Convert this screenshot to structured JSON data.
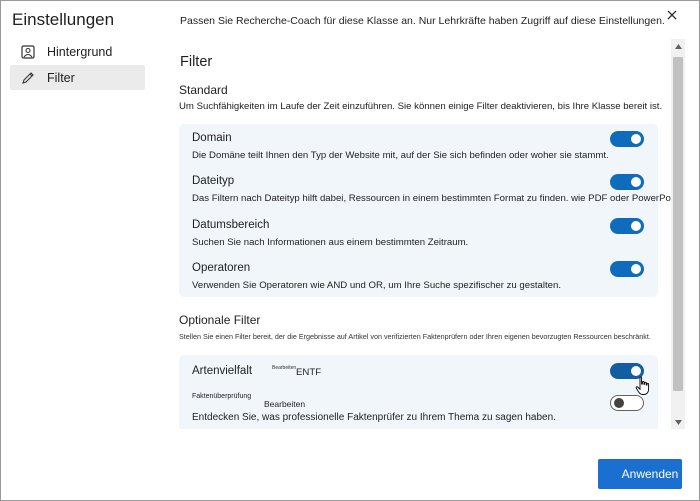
{
  "sidebar": {
    "title": "Einstellungen",
    "items": [
      {
        "label": "Hintergrund",
        "icon": "image-icon",
        "active": false
      },
      {
        "label": "Filter",
        "icon": "pencil-icon",
        "active": true
      }
    ]
  },
  "header": {
    "description": "Passen Sie Recherche-Coach für diese Klasse an. Nur Lehrkräfte haben Zugriff auf diese Einstellungen."
  },
  "panel": {
    "title": "Filter",
    "standard": {
      "heading": "Standard",
      "description": "Um Suchfähigkeiten im Laufe der Zeit einzuführen. Sie können einige Filter deaktivieren, bis Ihre Klasse bereit ist.",
      "items": [
        {
          "title": "Domain",
          "description": "Die Domäne teilt Ihnen den Typ der Website mit, auf der Sie sich befinden oder woher sie stammt.",
          "on": true
        },
        {
          "title": "Dateityp",
          "description": "Das Filtern nach Dateityp hilft dabei, Ressourcen in einem bestimmten Format zu finden. wie PDF oder PowerPoint.",
          "on": true
        },
        {
          "title": "Datumsbereich",
          "description": "Suchen Sie nach Informationen aus einem bestimmten Zeitraum.",
          "on": true
        },
        {
          "title": "Operatoren",
          "description": "Verwenden Sie Operatoren wie AND und OR, um Ihre Suche spezifischer zu gestalten.",
          "on": true
        }
      ]
    },
    "optional": {
      "heading": "Optionale Filter",
      "description": "Stellen Sie einen Filter bereit, der die Ergebnisse auf Artikel von verifizierten Faktenprüfern oder Ihren eigenen bevorzugten Ressourcen beschränkt.",
      "items": [
        {
          "title": "Artenvielfalt",
          "tiny_label": "Bearbeiten",
          "action_label": "ENTF",
          "on": true
        },
        {
          "title": "Faktenüberprüfung",
          "action_label": "Bearbeiten",
          "description": "Entdecken Sie, was professionelle Faktenprüfer zu Ihrem Thema zu sagen haben.",
          "on": false
        }
      ]
    }
  },
  "footer": {
    "apply_label": "Anwenden"
  },
  "colors": {
    "accent": "#0f6cbd",
    "card_bg": "#f1f6fb",
    "button_bg": "#1a6fd1"
  }
}
